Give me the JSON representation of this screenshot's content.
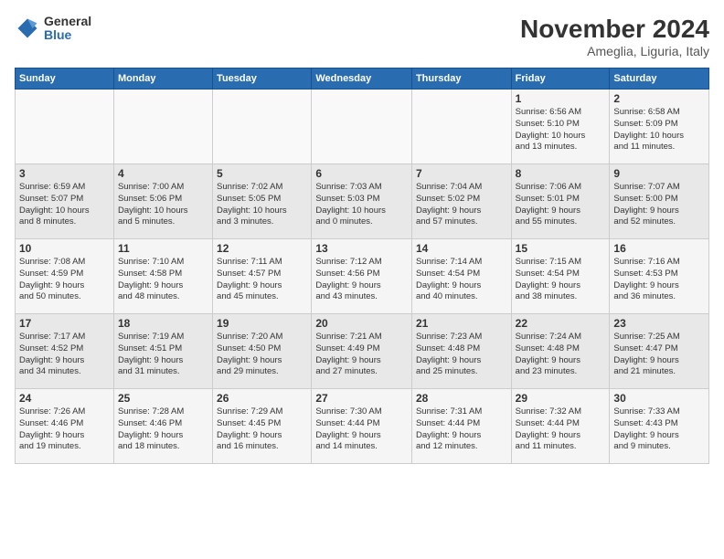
{
  "header": {
    "logo_general": "General",
    "logo_blue": "Blue",
    "month_title": "November 2024",
    "location": "Ameglia, Liguria, Italy"
  },
  "days_of_week": [
    "Sunday",
    "Monday",
    "Tuesday",
    "Wednesday",
    "Thursday",
    "Friday",
    "Saturday"
  ],
  "weeks": [
    [
      {
        "day": "",
        "info": ""
      },
      {
        "day": "",
        "info": ""
      },
      {
        "day": "",
        "info": ""
      },
      {
        "day": "",
        "info": ""
      },
      {
        "day": "",
        "info": ""
      },
      {
        "day": "1",
        "info": "Sunrise: 6:56 AM\nSunset: 5:10 PM\nDaylight: 10 hours\nand 13 minutes."
      },
      {
        "day": "2",
        "info": "Sunrise: 6:58 AM\nSunset: 5:09 PM\nDaylight: 10 hours\nand 11 minutes."
      }
    ],
    [
      {
        "day": "3",
        "info": "Sunrise: 6:59 AM\nSunset: 5:07 PM\nDaylight: 10 hours\nand 8 minutes."
      },
      {
        "day": "4",
        "info": "Sunrise: 7:00 AM\nSunset: 5:06 PM\nDaylight: 10 hours\nand 5 minutes."
      },
      {
        "day": "5",
        "info": "Sunrise: 7:02 AM\nSunset: 5:05 PM\nDaylight: 10 hours\nand 3 minutes."
      },
      {
        "day": "6",
        "info": "Sunrise: 7:03 AM\nSunset: 5:03 PM\nDaylight: 10 hours\nand 0 minutes."
      },
      {
        "day": "7",
        "info": "Sunrise: 7:04 AM\nSunset: 5:02 PM\nDaylight: 9 hours\nand 57 minutes."
      },
      {
        "day": "8",
        "info": "Sunrise: 7:06 AM\nSunset: 5:01 PM\nDaylight: 9 hours\nand 55 minutes."
      },
      {
        "day": "9",
        "info": "Sunrise: 7:07 AM\nSunset: 5:00 PM\nDaylight: 9 hours\nand 52 minutes."
      }
    ],
    [
      {
        "day": "10",
        "info": "Sunrise: 7:08 AM\nSunset: 4:59 PM\nDaylight: 9 hours\nand 50 minutes."
      },
      {
        "day": "11",
        "info": "Sunrise: 7:10 AM\nSunset: 4:58 PM\nDaylight: 9 hours\nand 48 minutes."
      },
      {
        "day": "12",
        "info": "Sunrise: 7:11 AM\nSunset: 4:57 PM\nDaylight: 9 hours\nand 45 minutes."
      },
      {
        "day": "13",
        "info": "Sunrise: 7:12 AM\nSunset: 4:56 PM\nDaylight: 9 hours\nand 43 minutes."
      },
      {
        "day": "14",
        "info": "Sunrise: 7:14 AM\nSunset: 4:54 PM\nDaylight: 9 hours\nand 40 minutes."
      },
      {
        "day": "15",
        "info": "Sunrise: 7:15 AM\nSunset: 4:54 PM\nDaylight: 9 hours\nand 38 minutes."
      },
      {
        "day": "16",
        "info": "Sunrise: 7:16 AM\nSunset: 4:53 PM\nDaylight: 9 hours\nand 36 minutes."
      }
    ],
    [
      {
        "day": "17",
        "info": "Sunrise: 7:17 AM\nSunset: 4:52 PM\nDaylight: 9 hours\nand 34 minutes."
      },
      {
        "day": "18",
        "info": "Sunrise: 7:19 AM\nSunset: 4:51 PM\nDaylight: 9 hours\nand 31 minutes."
      },
      {
        "day": "19",
        "info": "Sunrise: 7:20 AM\nSunset: 4:50 PM\nDaylight: 9 hours\nand 29 minutes."
      },
      {
        "day": "20",
        "info": "Sunrise: 7:21 AM\nSunset: 4:49 PM\nDaylight: 9 hours\nand 27 minutes."
      },
      {
        "day": "21",
        "info": "Sunrise: 7:23 AM\nSunset: 4:48 PM\nDaylight: 9 hours\nand 25 minutes."
      },
      {
        "day": "22",
        "info": "Sunrise: 7:24 AM\nSunset: 4:48 PM\nDaylight: 9 hours\nand 23 minutes."
      },
      {
        "day": "23",
        "info": "Sunrise: 7:25 AM\nSunset: 4:47 PM\nDaylight: 9 hours\nand 21 minutes."
      }
    ],
    [
      {
        "day": "24",
        "info": "Sunrise: 7:26 AM\nSunset: 4:46 PM\nDaylight: 9 hours\nand 19 minutes."
      },
      {
        "day": "25",
        "info": "Sunrise: 7:28 AM\nSunset: 4:46 PM\nDaylight: 9 hours\nand 18 minutes."
      },
      {
        "day": "26",
        "info": "Sunrise: 7:29 AM\nSunset: 4:45 PM\nDaylight: 9 hours\nand 16 minutes."
      },
      {
        "day": "27",
        "info": "Sunrise: 7:30 AM\nSunset: 4:44 PM\nDaylight: 9 hours\nand 14 minutes."
      },
      {
        "day": "28",
        "info": "Sunrise: 7:31 AM\nSunset: 4:44 PM\nDaylight: 9 hours\nand 12 minutes."
      },
      {
        "day": "29",
        "info": "Sunrise: 7:32 AM\nSunset: 4:44 PM\nDaylight: 9 hours\nand 11 minutes."
      },
      {
        "day": "30",
        "info": "Sunrise: 7:33 AM\nSunset: 4:43 PM\nDaylight: 9 hours\nand 9 minutes."
      }
    ]
  ]
}
